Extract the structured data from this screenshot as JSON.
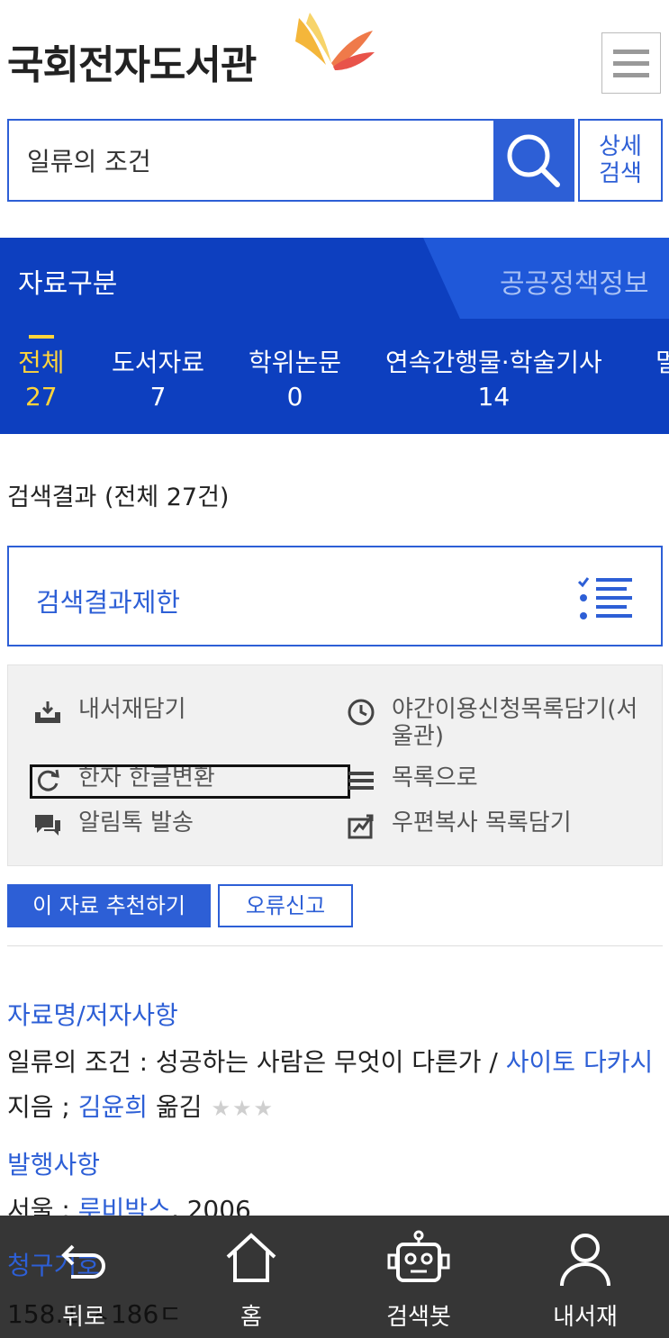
{
  "header": {
    "logo_text": "국회전자도서관",
    "menu_icon": "hamburger-icon"
  },
  "search": {
    "value": "일류의 조건",
    "advanced_line1": "상세",
    "advanced_line2": "검색"
  },
  "category": {
    "title": "자료구분",
    "policy_tab": "공공정책정보",
    "tabs": [
      {
        "label": "전체",
        "count": "27"
      },
      {
        "label": "도서자료",
        "count": "7"
      },
      {
        "label": "학위논문",
        "count": "0"
      },
      {
        "label": "연속간행물·학술기사",
        "count": "14"
      },
      {
        "label": "멀",
        "count": ""
      }
    ]
  },
  "results": {
    "summary": "검색결과 (전체 27건)",
    "limit_label": "검색결과제한"
  },
  "actions": {
    "add_my_library": "내서재담기",
    "night_request": "야간이용신청목록담기(서울관)",
    "hanja_convert": "한자 한글변환",
    "to_list": "목록으로",
    "send_alimtalk": "알림톡 발송",
    "mail_copy": "우편복사 목록담기"
  },
  "buttons": {
    "recommend": "이 자료 추천하기",
    "report_error": "오류신고"
  },
  "record": {
    "title_label": "자료명/저자사항",
    "title_text": "일류의 조건 : 성공하는 사람은 무엇이 다른가 / ",
    "author_link": "사이토 다카시",
    "line2_prefix": "지음 ; ",
    "translator_link": "김윤희",
    "line2_suffix": " 옮김",
    "pub_label": "발행사항",
    "pub_prefix": "서울 : ",
    "publisher_link": "루비박스",
    "pub_suffix": ", 2006",
    "call_label": "청구기호",
    "call_number": "158.1 ㅅ186ㄷ"
  },
  "bottom_nav": {
    "back": "뒤로",
    "home": "홈",
    "searchbot": "검색봇",
    "my_library": "내서재"
  },
  "colors": {
    "primary": "#2d5fd6",
    "band": "#0d3fbf",
    "accent": "#ffd43b",
    "nav_bg": "#363636"
  }
}
